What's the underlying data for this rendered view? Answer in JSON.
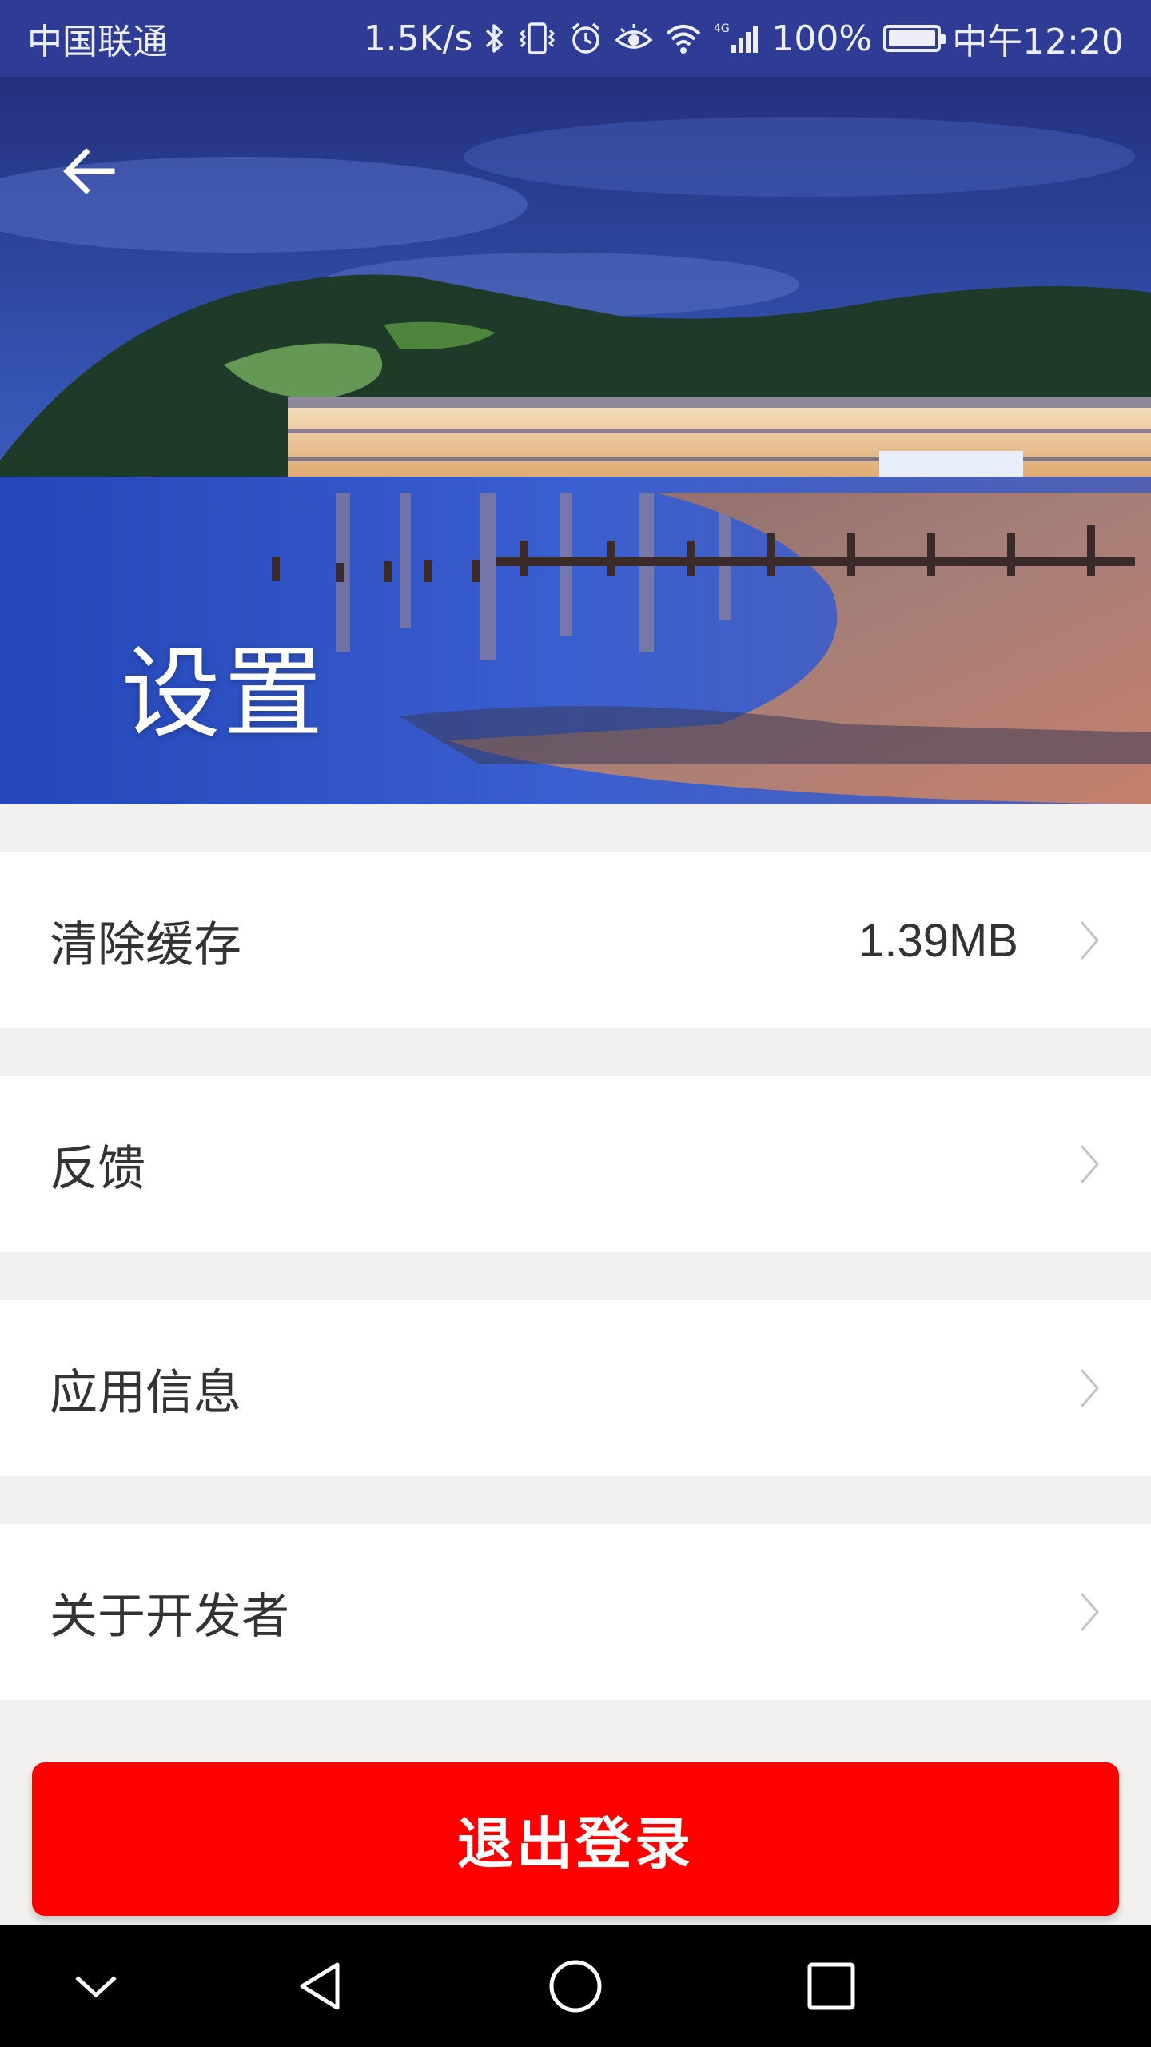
{
  "status_bar": {
    "carrier": "中国联通",
    "net_speed": "1.5K/s",
    "network_type": "4G",
    "battery": "100%",
    "battery_level": 1.0,
    "time": "中午12:20",
    "icons": [
      "bluetooth-icon",
      "vibrate-icon",
      "alarm-icon",
      "eye-icon",
      "wifi-icon",
      "signal-icon",
      "battery-icon"
    ]
  },
  "header": {
    "title": "设置",
    "back_icon": "arrow-left-icon",
    "image": "seaside-town-night-photo"
  },
  "settings": {
    "items": [
      {
        "label": "清除缓存",
        "value": "1.39MB",
        "icon": "chevron-right-icon"
      },
      {
        "label": "反馈",
        "value": "",
        "icon": "chevron-right-icon"
      },
      {
        "label": "应用信息",
        "value": "",
        "icon": "chevron-right-icon"
      },
      {
        "label": "关于开发者",
        "value": "",
        "icon": "chevron-right-icon"
      }
    ]
  },
  "logout": {
    "label": "退出登录"
  },
  "nav_bar": {
    "icons": [
      "chevron-down-icon",
      "back-triangle-icon",
      "home-circle-icon",
      "recents-square-icon"
    ]
  },
  "colors": {
    "status_bar_bg": "#2f3c96",
    "page_bg": "#f2f1ef",
    "row_bg": "#ffffff",
    "text_primary": "#333333",
    "chevron": "#c4c4c4",
    "logout_bg": "#fe0000",
    "nav_bar_bg": "#000000"
  }
}
